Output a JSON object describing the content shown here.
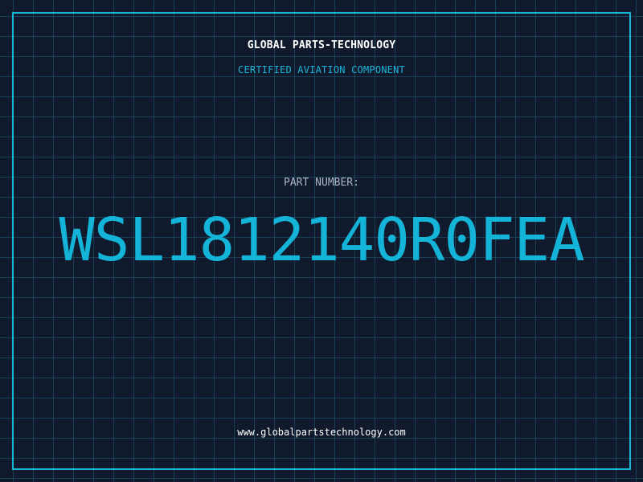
{
  "header": {
    "company": "GLOBAL PARTS-TECHNOLOGY",
    "tagline": "CERTIFIED AVIATION COMPONENT"
  },
  "part": {
    "label": "PART NUMBER:",
    "number": "WSL1812140R0FEA"
  },
  "footer": {
    "website": "www.globalpartstechnology.com"
  },
  "colors": {
    "background": "#111a2c",
    "accent": "#1ab5d8",
    "grid": "#1e5f78",
    "text": "#ffffff",
    "label": "#a9b7c6"
  }
}
